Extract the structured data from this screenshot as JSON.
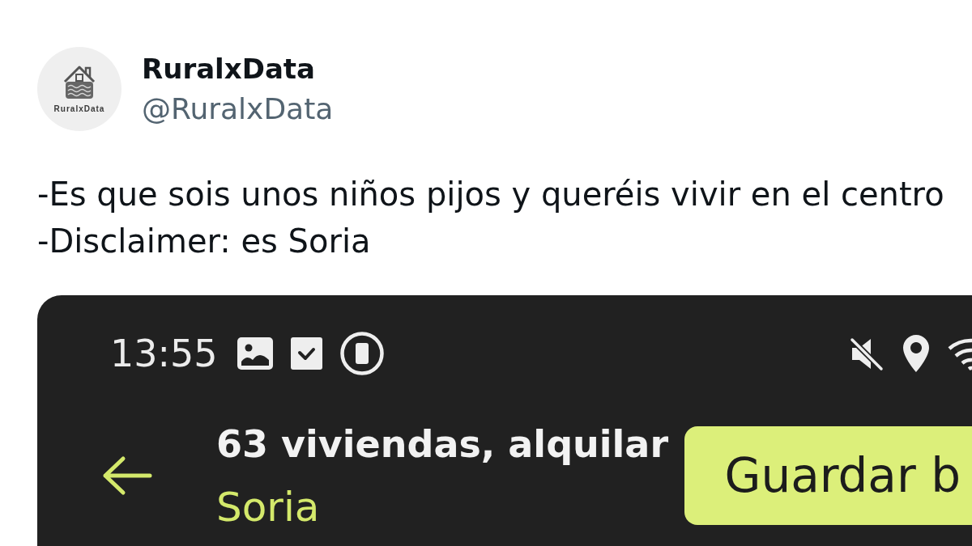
{
  "tweet": {
    "author": {
      "name": "RuralxData",
      "handle": "@RuralxData",
      "avatar_logo_text": "RuralxData"
    },
    "text_lines": [
      "-Es que sois unos niños pijos y queréis vivir en el centro",
      "-Disclaimer: es Soria"
    ],
    "attached_screenshot": {
      "status_bar": {
        "time": "13:55"
      },
      "app_bar": {
        "title": "63 viviendas, alquilar",
        "subtitle": "Soria",
        "action_button": "Guardar b"
      }
    }
  }
}
